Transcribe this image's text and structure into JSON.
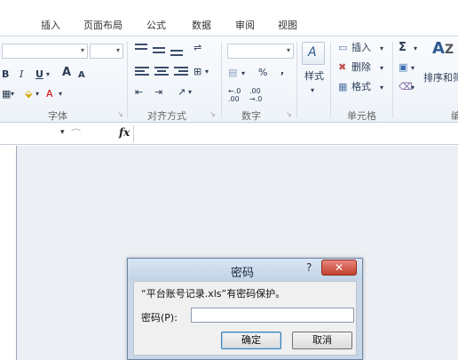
{
  "tabs": [
    "插入",
    "页面布局",
    "公式",
    "数据",
    "审阅",
    "视图"
  ],
  "ribbon": {
    "groups": {
      "font": "字体",
      "alignment": "对齐方式",
      "number": "数字",
      "cells": "单元格"
    },
    "font": {
      "bold": "B",
      "italic": "I",
      "underline": "U",
      "grow": "A",
      "shrink": "A",
      "font_color": "A",
      "dropdown": "▾"
    },
    "number": {
      "percent": "%",
      "comma": ",",
      "inc_decimal": "←.0 .00",
      "dec_decimal": ".00 →.0"
    },
    "styles_label": "样式",
    "cells": {
      "insert": "插入",
      "delete": "删除",
      "format": "格式"
    },
    "editing": {
      "sum_icon": "Σ",
      "sort_filter": "排序和筛",
      "cut_label": "编"
    }
  },
  "formula_bar": {
    "fx": "fx"
  },
  "dialog": {
    "title": "密码",
    "help": "?",
    "close": "✕",
    "message": "“平台账号记录.xls”有密码保护。",
    "password_label": "密码(P):",
    "password_value": "",
    "ok": "确定",
    "cancel": "取消"
  }
}
